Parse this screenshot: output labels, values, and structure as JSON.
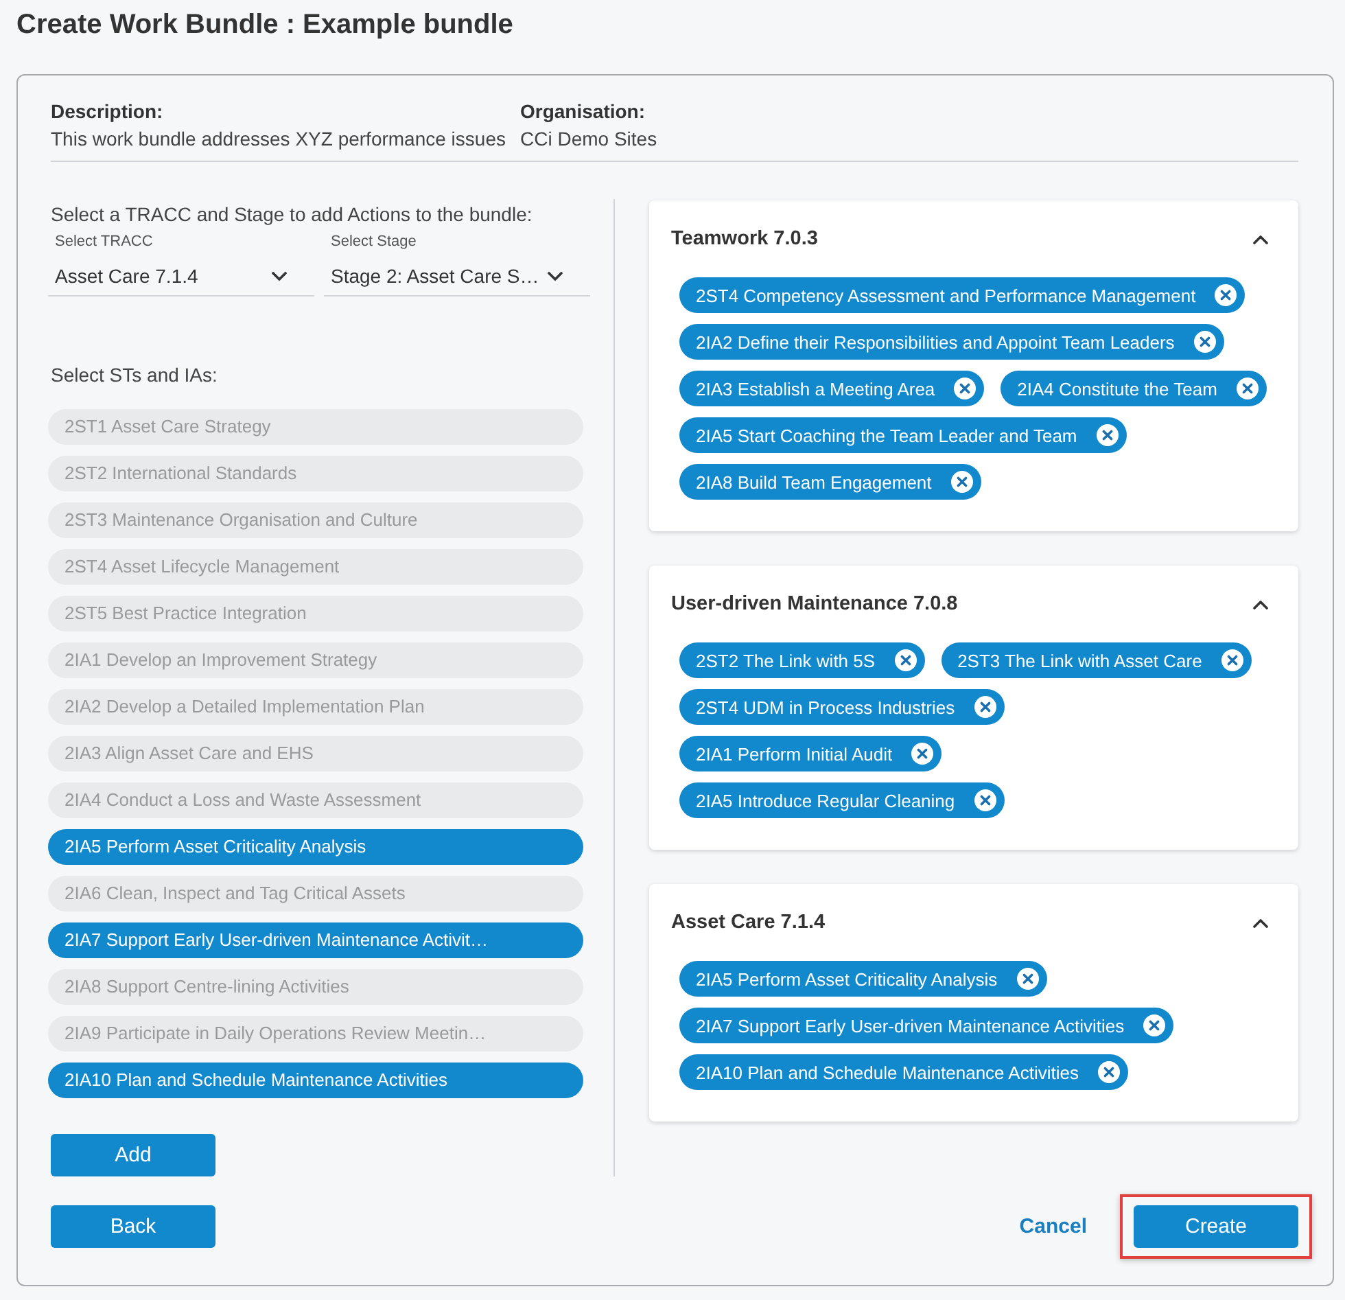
{
  "page": {
    "title": "Create Work Bundle : Example bundle"
  },
  "details": {
    "description_label": "Description:",
    "description": "This work bundle addresses XYZ performance issues",
    "organisation_label": "Organisation:",
    "organisation": "CCi Demo Sites"
  },
  "selector": {
    "instruction": "Select a TRACC and Stage to add Actions to the bundle:",
    "fields": [
      {
        "label": "Select TRACC",
        "value": "Asset Care 7.1.4"
      },
      {
        "label": "Select Stage",
        "value": "Stage 2: Asset Care S…"
      }
    ],
    "list_heading": "Select STs and IAs:",
    "items": [
      {
        "label": "2ST1 Asset Care Strategy",
        "selected": false
      },
      {
        "label": "2ST2 International Standards",
        "selected": false
      },
      {
        "label": "2ST3 Maintenance Organisation and Culture",
        "selected": false
      },
      {
        "label": "2ST4 Asset Lifecycle Management",
        "selected": false
      },
      {
        "label": "2ST5 Best Practice Integration",
        "selected": false
      },
      {
        "label": "2IA1 Develop an Improvement Strategy",
        "selected": false
      },
      {
        "label": "2IA2 Develop a Detailed Implementation Plan",
        "selected": false
      },
      {
        "label": "2IA3 Align Asset Care and EHS",
        "selected": false
      },
      {
        "label": "2IA4 Conduct a Loss and Waste Assessment",
        "selected": false
      },
      {
        "label": "2IA5 Perform Asset Criticality Analysis",
        "selected": true
      },
      {
        "label": "2IA6 Clean, Inspect and Tag Critical Assets",
        "selected": false
      },
      {
        "label": "2IA7 Support Early User-driven Maintenance Activit…",
        "selected": true
      },
      {
        "label": "2IA8 Support Centre-lining Activities",
        "selected": false
      },
      {
        "label": "2IA9 Participate in Daily Operations Review Meetin…",
        "selected": false
      },
      {
        "label": "2IA10 Plan and Schedule Maintenance Activities",
        "selected": true
      }
    ],
    "add_button": "Add"
  },
  "bundle": [
    {
      "title": "Teamwork 7.0.3",
      "expanded": true,
      "actions": [
        "2ST4 Competency Assessment and Performance Management",
        "2IA2 Define their Responsibilities and Appoint Team Leaders",
        "2IA3 Establish a Meeting Area",
        "2IA4 Constitute the Team",
        "2IA5 Start Coaching the Team Leader and Team",
        "2IA8 Build Team Engagement"
      ]
    },
    {
      "title": "User-driven Maintenance 7.0.8",
      "expanded": true,
      "actions": [
        "2ST2 The Link with 5S",
        "2ST3 The Link with Asset Care",
        "2ST4 UDM in Process Industries",
        "2IA1 Perform Initial Audit",
        "2IA5 Introduce Regular Cleaning"
      ]
    },
    {
      "title": "Asset Care 7.1.4",
      "expanded": true,
      "actions": [
        "2IA5 Perform Asset Criticality Analysis",
        "2IA7 Support Early User-driven Maintenance Activities",
        "2IA10 Plan and Schedule Maintenance Activities"
      ]
    }
  ],
  "footer": {
    "back_button": "Back",
    "cancel_link": "Cancel",
    "create_button": {
      "label": "Create",
      "highlighted": true
    }
  }
}
